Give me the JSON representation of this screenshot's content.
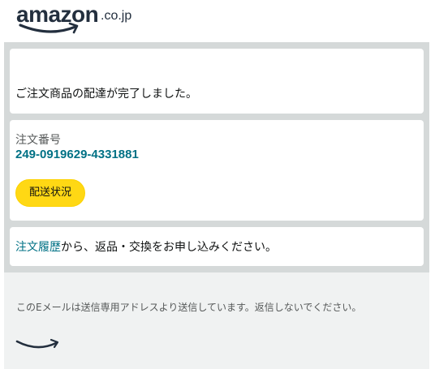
{
  "header": {
    "logo_word": "amazon",
    "logo_tld": ".co.jp"
  },
  "card_delivery": {
    "message": "ご注文商品の配達が完了しました。"
  },
  "card_order": {
    "label": "注文番号",
    "number": "249-0919629-4331881",
    "status_button": "配送状況"
  },
  "card_return": {
    "link_text": "注文履歴",
    "rest_text": "から、返品・交換をお申し込みください。"
  },
  "footer": {
    "notice": "このEメールは送信専用アドレスより送信しています。返信しないでください。"
  },
  "colors": {
    "link": "#007185",
    "button": "#ffd814",
    "divider_gray": "#d5d9d9",
    "footer_bg": "#f0f2f2",
    "logo_dark": "#232f3e"
  },
  "icons": {
    "logo_smile": "amazon-smile-arrow-icon",
    "footer_smile": "amazon-smile-arrow-icon"
  }
}
